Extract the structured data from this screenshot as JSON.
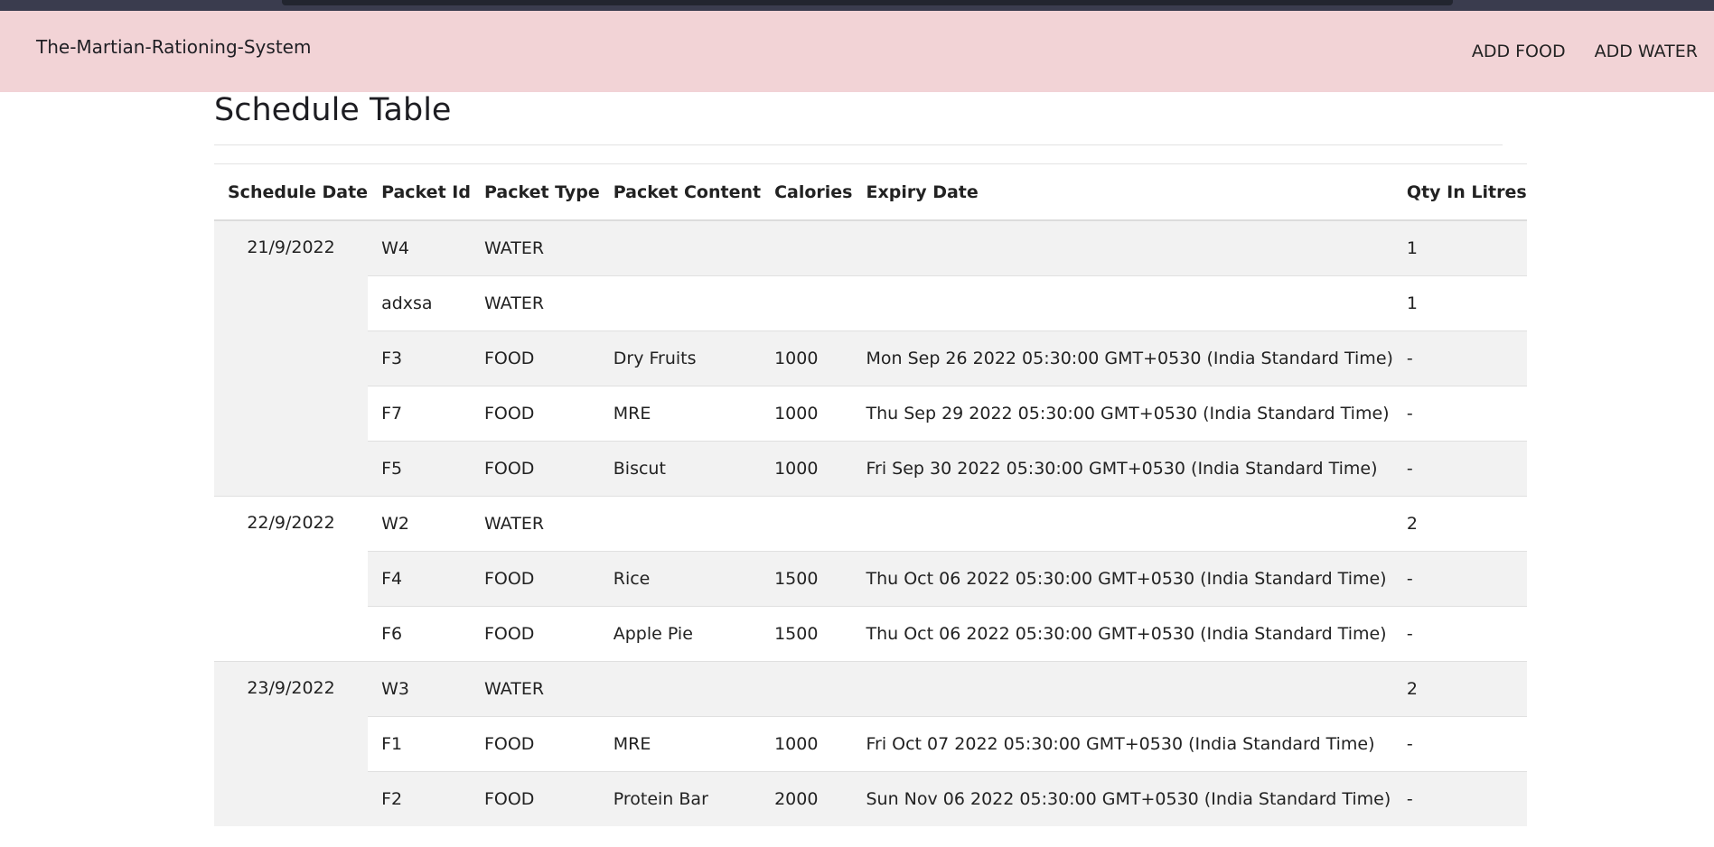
{
  "navbar": {
    "brand": "The-Martian-Rationing-System",
    "links": [
      "ADD FOOD",
      "ADD WATER"
    ]
  },
  "page": {
    "title": "Schedule Table"
  },
  "table": {
    "headers": [
      "Schedule Date",
      "Packet Id",
      "Packet Type",
      "Packet Content",
      "Calories",
      "Expiry Date",
      "Qty In Litres"
    ],
    "groups": [
      {
        "date": "21/9/2022",
        "rows": [
          [
            "W4",
            "WATER",
            "",
            "",
            "",
            "1"
          ],
          [
            "adxsa",
            "WATER",
            "",
            "",
            "",
            "1"
          ],
          [
            "F3",
            "FOOD",
            "Dry Fruits",
            "1000",
            "Mon Sep 26 2022 05:30:00 GMT+0530 (India Standard Time)",
            "-"
          ],
          [
            "F7",
            "FOOD",
            "MRE",
            "1000",
            "Thu Sep 29 2022 05:30:00 GMT+0530 (India Standard Time)",
            "-"
          ],
          [
            "F5",
            "FOOD",
            "Biscut",
            "1000",
            "Fri Sep 30 2022 05:30:00 GMT+0530 (India Standard Time)",
            "-"
          ]
        ]
      },
      {
        "date": "22/9/2022",
        "rows": [
          [
            "W2",
            "WATER",
            "",
            "",
            "",
            "2"
          ],
          [
            "F4",
            "FOOD",
            "Rice",
            "1500",
            "Thu Oct 06 2022 05:30:00 GMT+0530 (India Standard Time)",
            "-"
          ],
          [
            "F6",
            "FOOD",
            "Apple Pie",
            "1500",
            "Thu Oct 06 2022 05:30:00 GMT+0530 (India Standard Time)",
            "-"
          ]
        ]
      },
      {
        "date": "23/9/2022",
        "rows": [
          [
            "W3",
            "WATER",
            "",
            "",
            "",
            "2"
          ],
          [
            "F1",
            "FOOD",
            "MRE",
            "1000",
            "Fri Oct 07 2022 05:30:00 GMT+0530 (India Standard Time)",
            "-"
          ],
          [
            "F2",
            "FOOD",
            "Protein Bar",
            "2000",
            "Sun Nov 06 2022 05:30:00 GMT+0530 (India Standard Time)",
            "-"
          ]
        ]
      }
    ]
  }
}
